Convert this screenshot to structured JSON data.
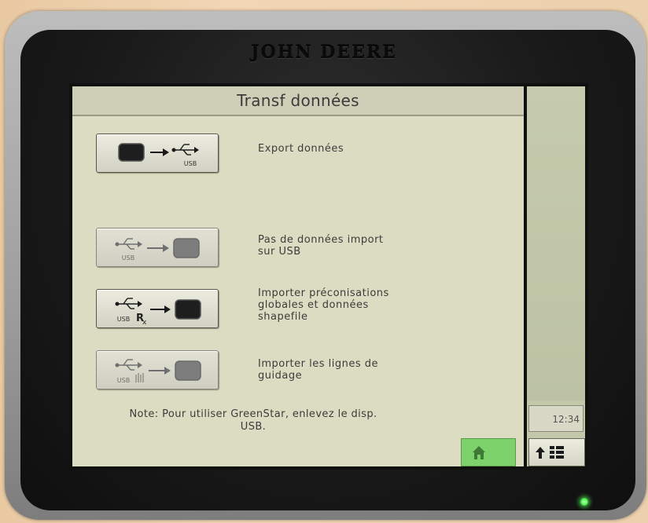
{
  "device": {
    "brand": "JOHN DEERE"
  },
  "header": {
    "title": "Transf données"
  },
  "options": [
    {
      "label": "Export données",
      "icon": "display-to-usb-icon",
      "usb_label": "USB",
      "enabled": true
    },
    {
      "label": "Pas de données import\nsur USB",
      "icon": "usb-to-display-icon",
      "usb_label": "USB",
      "enabled": false
    },
    {
      "label": "Importer préconisations\nglobales et données\nshapefile",
      "icon": "usb-rx-to-display-icon",
      "usb_label": "USB",
      "enabled": true
    },
    {
      "label": "Importer les lignes de\nguidage",
      "icon": "usb-guidance-to-display-icon",
      "usb_label": "USB",
      "enabled": false
    }
  ],
  "note": "Note: Pour utiliser GreenStar, enlevez le disp.\nUSB.",
  "status": {
    "time": "12:34"
  },
  "nav": {
    "home_icon": "home-icon",
    "menu_icon": "up-arrow-menu-icon"
  },
  "colors": {
    "screen_bg": "#dcdcc2",
    "home_button": "#7ed26c",
    "led": "#5cff5c"
  }
}
